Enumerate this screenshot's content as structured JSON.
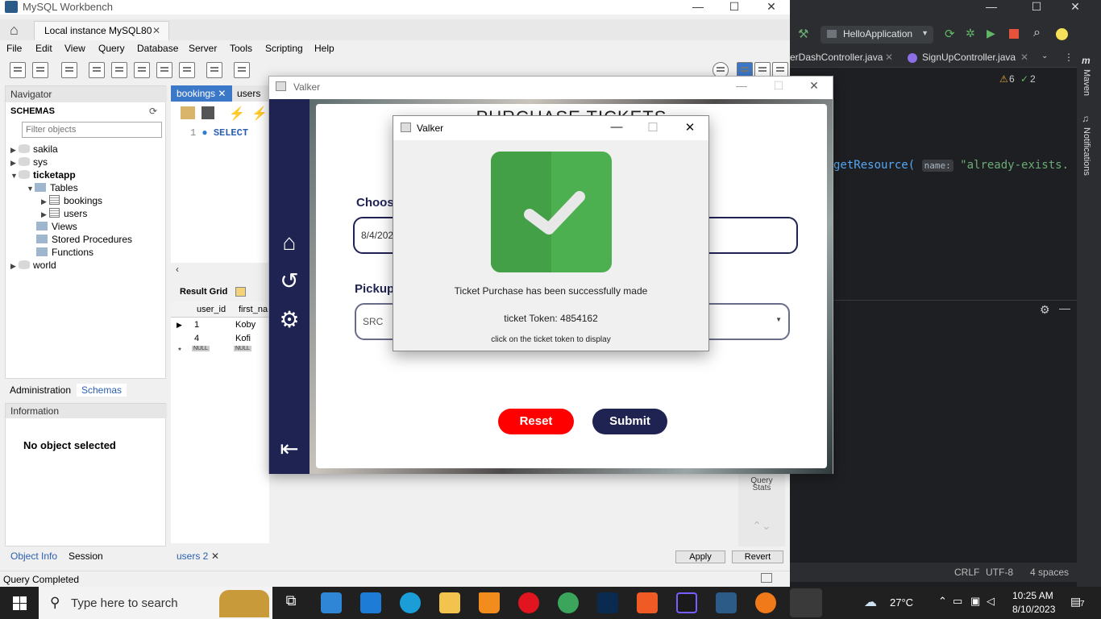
{
  "workbench": {
    "title": "MySQL Workbench",
    "instance_tab": "Local instance MySQL80",
    "menu": [
      "File",
      "Edit",
      "View",
      "Query",
      "Database",
      "Server",
      "Tools",
      "Scripting",
      "Help"
    ],
    "navigator": {
      "header": "Navigator",
      "schemas_label": "SCHEMAS",
      "filter_placeholder": "Filter objects",
      "tree": {
        "sakila": "sakila",
        "sys": "sys",
        "ticketapp": "ticketapp",
        "tables": "Tables",
        "bookings": "bookings",
        "users": "users",
        "views": "Views",
        "stored_procedures": "Stored Procedures",
        "functions": "Functions",
        "world": "world"
      }
    },
    "side_tabs": {
      "administration": "Administration",
      "schemas": "Schemas"
    },
    "information": {
      "header": "Information",
      "no_object": "No object selected"
    },
    "bottom_tabs": {
      "object_info": "Object Info",
      "session": "Session"
    },
    "editor": {
      "tab_bookings": "bookings",
      "tab_users": "users",
      "line_number": "1",
      "sql": "SELECT"
    },
    "result": {
      "label": "Result Grid",
      "columns": [
        "user_id",
        "first_na"
      ],
      "rows": [
        [
          "1",
          "Koby"
        ],
        [
          "4",
          "Kofi"
        ]
      ],
      "null_label": "NULL",
      "bottom_tab": "users 2",
      "apply": "Apply",
      "revert": "Revert",
      "query_stats": "Query Stats"
    },
    "status": "Query Completed"
  },
  "intellij": {
    "run_config": "HelloApplication",
    "tabs": [
      "erDashController.java",
      "SignUpController.java"
    ],
    "warnings": "6",
    "checks": "2",
    "code_fn": "getResource(",
    "code_hint": "name:",
    "code_str": "\"already-exists.",
    "side_maven": "Maven",
    "side_notifications": "Notifications",
    "status": {
      "crlf": "CRLF",
      "encoding": "UTF-8",
      "indent": "4 spaces"
    }
  },
  "valker": {
    "title": "Valker",
    "heading": "PURCHASE TICKETS",
    "choose_label": "Choos",
    "date_value": "8/4/202",
    "pickup_label": "Pickup",
    "pickup_value": "SRC",
    "reset": "Reset",
    "submit": "Submit"
  },
  "dialog": {
    "title": "Valker",
    "message": "Ticket Purchase has been successfully made",
    "token": "ticket Token: 4854162",
    "hint": "click on the ticket token to display",
    "colors": {
      "check_dark": "#43a047",
      "check_light": "#4caf50"
    }
  },
  "taskbar": {
    "search_placeholder": "Type here to search",
    "weather": "27°C",
    "time": "10:25 AM",
    "date": "8/10/2023",
    "notifications": "7"
  }
}
